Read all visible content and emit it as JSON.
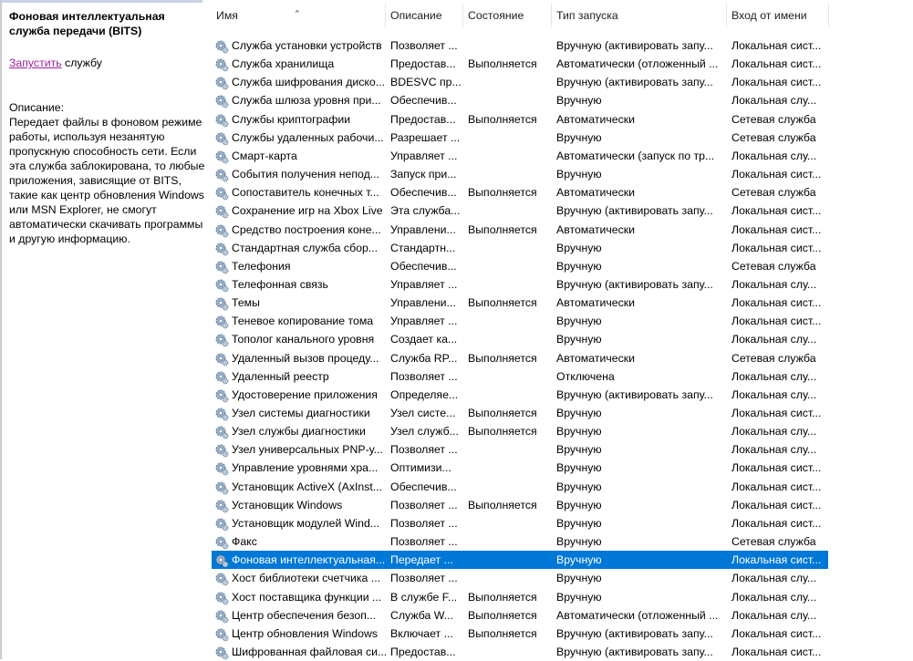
{
  "left": {
    "title": "Фоновая интеллектуальная служба передачи (BITS)",
    "action_link": "Запустить",
    "action_rest": " службу",
    "desc_label": "Описание:",
    "desc_text": "Передает файлы в фоновом режиме работы, используя незанятую пропускную способность сети. Если эта служба заблокирована, то любые приложения, зависящие от BITS, такие как центр обновления Windows или MSN Explorer, не смогут автоматически скачивать программы и другую информацию."
  },
  "columns": [
    "Имя",
    "Описание",
    "Состояние",
    "Тип запуска",
    "Вход от имени"
  ],
  "selected_index": 28,
  "rows": [
    [
      "Служба установки устройств",
      "Позволяет ...",
      "",
      "Вручную (активировать запу...",
      "Локальная сист..."
    ],
    [
      "Служба хранилища",
      "Предостав...",
      "Выполняется",
      "Автоматически (отложенный ...",
      "Локальная сист..."
    ],
    [
      "Служба шифрования диско...",
      "BDESVC пр...",
      "",
      "Вручную (активировать запу...",
      "Локальная сист..."
    ],
    [
      "Служба шлюза уровня при...",
      "Обеспечив...",
      "",
      "Вручную",
      "Локальная слу..."
    ],
    [
      "Службы криптографии",
      "Предостав...",
      "Выполняется",
      "Автоматически",
      "Сетевая служба"
    ],
    [
      "Службы удаленных рабочи...",
      "Разрешает ...",
      "",
      "Вручную",
      "Сетевая служба"
    ],
    [
      "Смарт-карта",
      "Управляет ...",
      "",
      "Автоматически (запуск по тр...",
      "Локальная слу..."
    ],
    [
      "События получения непод...",
      "Запуск при...",
      "",
      "Вручную",
      "Локальная сист..."
    ],
    [
      "Сопоставитель конечных т...",
      "Обеспечив...",
      "Выполняется",
      "Автоматически",
      "Сетевая служба"
    ],
    [
      "Сохранение игр на Xbox Live",
      "Эта служба...",
      "",
      "Вручную (активировать запу...",
      "Локальная сист..."
    ],
    [
      "Средство построения коне...",
      "Управлени...",
      "Выполняется",
      "Автоматически",
      "Локальная сист..."
    ],
    [
      "Стандартная служба сбор...",
      "Стандартн...",
      "",
      "Вручную",
      "Локальная сист..."
    ],
    [
      "Телефония",
      "Обеспечив...",
      "",
      "Вручную",
      "Сетевая служба"
    ],
    [
      "Телефонная связь",
      "Управляет ...",
      "",
      "Вручную (активировать запу...",
      "Локальная слу..."
    ],
    [
      "Темы",
      "Управлени...",
      "Выполняется",
      "Автоматически",
      "Локальная сист..."
    ],
    [
      "Теневое копирование тома",
      "Управляет ...",
      "",
      "Вручную",
      "Локальная сист..."
    ],
    [
      "Тополог канального уровня",
      "Создает ка...",
      "",
      "Вручную",
      "Локальная слу..."
    ],
    [
      "Удаленный вызов процеду...",
      "Служба RP...",
      "Выполняется",
      "Автоматически",
      "Сетевая служба"
    ],
    [
      "Удаленный реестр",
      "Позволяет ...",
      "",
      "Отключена",
      "Локальная слу..."
    ],
    [
      "Удостоверение приложения",
      "Определяе...",
      "",
      "Вручную (активировать запу...",
      "Локальная слу..."
    ],
    [
      "Узел системы диагностики",
      "Узел систе...",
      "Выполняется",
      "Вручную",
      "Локальная сист..."
    ],
    [
      "Узел службы диагностики",
      "Узел служб...",
      "Выполняется",
      "Вручную",
      "Локальная слу..."
    ],
    [
      "Узел универсальных PNP-у...",
      "Позволяет ...",
      "",
      "Вручную",
      "Локальная слу..."
    ],
    [
      "Управление уровнями хра...",
      "Оптимизи...",
      "",
      "Вручную",
      "Локальная сист..."
    ],
    [
      "Установщик ActiveX (AxInst...",
      "Обеспечив...",
      "",
      "Вручную",
      "Локальная сист..."
    ],
    [
      "Установщик Windows",
      "Позволяет ...",
      "Выполняется",
      "Вручную",
      "Локальная сист..."
    ],
    [
      "Установщик модулей Wind...",
      "Позволяет ...",
      "",
      "Вручную",
      "Локальная сист..."
    ],
    [
      "Факс",
      "Позволяет ...",
      "",
      "Вручную",
      "Сетевая служба"
    ],
    [
      "Фоновая интеллектуальная...",
      "Передает ...",
      "",
      "Вручную",
      "Локальная сист..."
    ],
    [
      "Хост библиотеки счетчика ...",
      "Позволяет ...",
      "",
      "Вручную",
      "Локальная слу..."
    ],
    [
      "Хост поставщика функции ...",
      "В службе F...",
      "Выполняется",
      "Вручную",
      "Локальная слу..."
    ],
    [
      "Центр обеспечения безоп...",
      "Служба W...",
      "Выполняется",
      "Автоматически (отложенный ...",
      "Локальная слу..."
    ],
    [
      "Центр обновления Windows",
      "Включает ...",
      "Выполняется",
      "Вручную (активировать запу...",
      "Локальная сист..."
    ],
    [
      "Шифрованная файловая си...",
      "Предостав...",
      "",
      "Вручную (активировать запу...",
      "Локальная сист..."
    ]
  ]
}
